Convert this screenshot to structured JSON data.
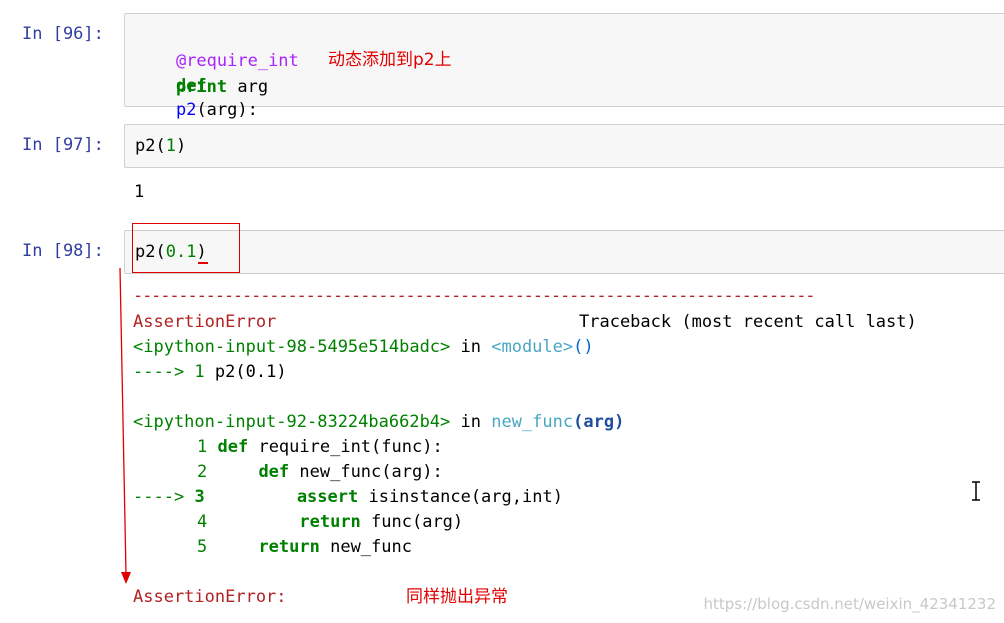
{
  "cells": [
    {
      "prompt": "In  [96]:",
      "lines": [
        {
          "decorator": "@require_int"
        },
        {
          "kw": "def",
          "name": "p2",
          "args": "(arg):"
        },
        {
          "indent": "    ",
          "kw": "print",
          "rest": " arg"
        }
      ],
      "annotation": "动态添加到p2上"
    },
    {
      "prompt": "In  [97]:",
      "code": {
        "fn": "p2",
        "open": "(",
        "num": "1",
        "close": ")"
      },
      "output": "1"
    },
    {
      "prompt": "In  [98]:",
      "code": {
        "fn": "p2",
        "open": "(",
        "num": "0.1",
        "close": ")"
      }
    }
  ],
  "traceback": {
    "dashes": "---------------------------------------------------------------------------",
    "error_type": "AssertionError",
    "header_right": "Traceback (most recent call last)",
    "frame1": {
      "source": "<ipython-input-98-5495e514badc>",
      "in": " in ",
      "func": "<module>",
      "args": "()"
    },
    "frame1_line": {
      "arrow": "---->",
      "num": " 1 ",
      "code": "p2(0.1)"
    },
    "frame2": {
      "source": "<ipython-input-92-83224ba662b4>",
      "in": " in ",
      "func": "new_func",
      "args": "(arg)"
    },
    "frame2_lines": [
      {
        "num": "1",
        "kw": "def",
        "rest": " require_int(func):"
      },
      {
        "num": "2",
        "kw": "def",
        "rest": " new_func(arg):"
      },
      {
        "arrow": "---->",
        "num": "3",
        "kw": "assert",
        "rest": " isinstance(arg,int)"
      },
      {
        "num": "4",
        "kw": "return",
        "rest": " func(arg)"
      },
      {
        "num": "5",
        "kw": "return",
        "rest": " new_func"
      }
    ],
    "final_error": "AssertionError:",
    "annotation": "同样抛出异常"
  },
  "watermark": "https://blog.csdn.net/weixin_42341232",
  "colors": {
    "annotation": "#e00000",
    "prompt": "#303f9f",
    "error": "#b22222"
  }
}
